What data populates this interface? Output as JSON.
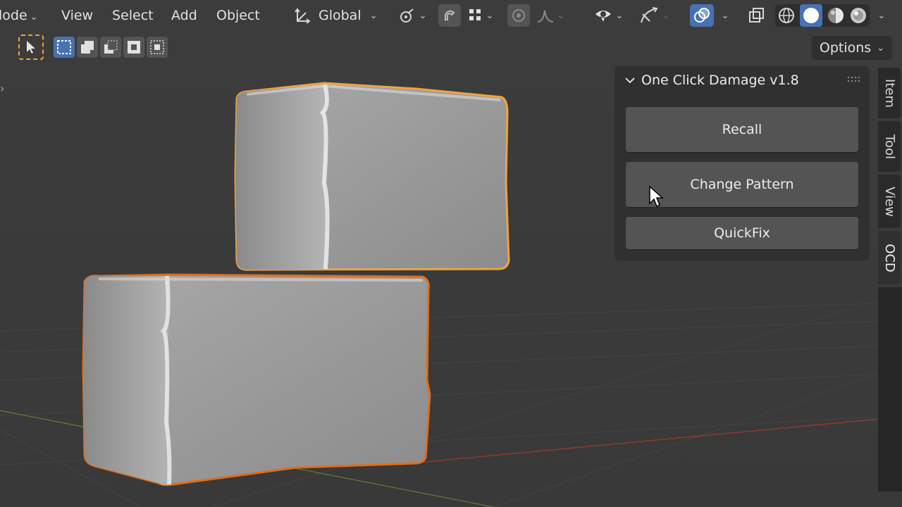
{
  "header": {
    "mode_label": "lode",
    "menus": [
      "View",
      "Select",
      "Add",
      "Object"
    ],
    "orientation_label": "Global"
  },
  "tools": {
    "options_label": "Options"
  },
  "panel": {
    "title": "One Click Damage v1.8",
    "buttons": [
      "Recall",
      "Change Pattern",
      "QuickFix"
    ]
  },
  "tabs": [
    "Item",
    "Tool",
    "View",
    "OCD"
  ],
  "colors": {
    "accent": "#4772b3",
    "selection_outline": "#f07a1a",
    "active_selection": "#f3a948",
    "button": "#545454",
    "panel": "#303030",
    "viewport": "#3d3d3d"
  },
  "icons": {
    "orientation": "transform-orientation-icon",
    "pivot": "pivot-point-icon",
    "snap": "snap-magnet-icon",
    "proportional": "proportional-editing-icon",
    "visibility": "selectability-visibility-icon",
    "gizmo": "gizmo-icon",
    "overlay": "overlay-icon",
    "xray": "xray-icon",
    "shading": [
      "wireframe-icon",
      "solid-icon",
      "material-preview-icon",
      "rendered-icon"
    ]
  }
}
